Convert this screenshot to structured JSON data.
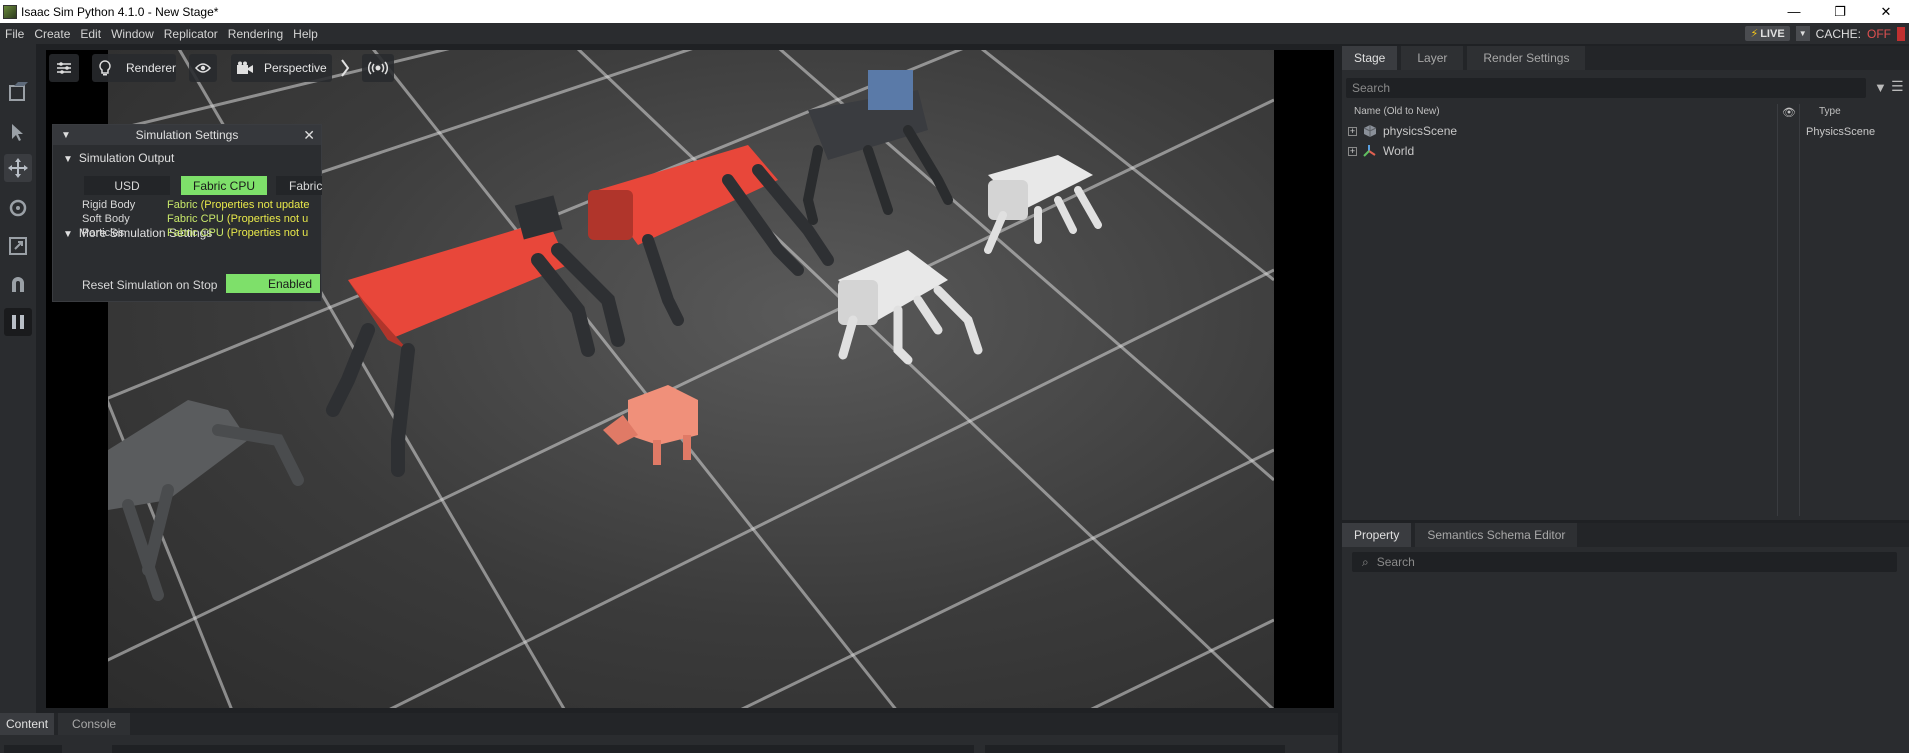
{
  "window": {
    "title": "Isaac Sim Python 4.1.0 - New Stage*",
    "controls": [
      "—",
      "❐",
      "✕"
    ]
  },
  "menu": {
    "items": [
      "File",
      "Create",
      "Edit",
      "Window",
      "Replicator",
      "Rendering",
      "Help"
    ],
    "live_label": "LIVE",
    "cache_label": "CACHE:",
    "cache_status": "OFF"
  },
  "viewport": {
    "renderer_label": "Renderer",
    "camera_label": "Perspective"
  },
  "sim_settings": {
    "title": "Simulation Settings",
    "output_section": "Simulation Output",
    "output_options": [
      "USD",
      "Fabric CPU",
      "Fabric"
    ],
    "selected_option": "Fabric CPU",
    "rows": [
      {
        "label": "Rigid Body",
        "prefix": "Fabric",
        "note": "(Properties not update"
      },
      {
        "label": "Soft Body",
        "prefix": "Fabric CPU",
        "note": "(Properties not u"
      },
      {
        "label": "Particles",
        "prefix": "Fabric CPU",
        "note": "(Properties not u"
      }
    ],
    "more_section": "More Simulation Settings",
    "reset_label": "Reset Simulation on Stop",
    "reset_value": "Enabled"
  },
  "stage": {
    "tabs": [
      "Stage",
      "Layer",
      "Render Settings"
    ],
    "search_placeholder": "Search",
    "col_name": "Name (Old to New)",
    "col_type": "Type",
    "items": [
      {
        "name": "physicsScene",
        "type": "PhysicsScene"
      },
      {
        "name": "World",
        "type": ""
      }
    ]
  },
  "property": {
    "tabs": [
      "Property",
      "Semantics Schema Editor"
    ],
    "search_placeholder": "Search"
  },
  "bottom": {
    "tabs": [
      "Content",
      "Console"
    ]
  },
  "colors": {
    "accent_green": "#7ee06a",
    "robot_red": "#e8473a",
    "robot_white": "#e8e8e8",
    "cube_salmon": "#f0907a"
  }
}
